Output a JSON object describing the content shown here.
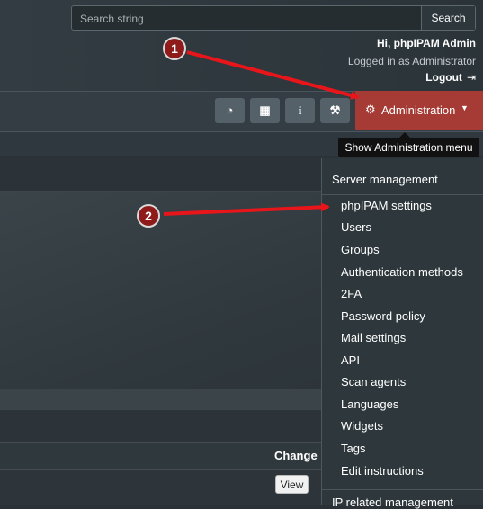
{
  "search": {
    "placeholder": "Search string",
    "button": "Search"
  },
  "user": {
    "greeting": "Hi, phpIPAM Admin",
    "logged_in_as": "Logged in as  Administrator",
    "logout": "Logout"
  },
  "navbar": {
    "icons": [
      "dashboard-icon",
      "tools-grid-icon",
      "info-icon",
      "wrench-icon"
    ],
    "admin_label": "Administration"
  },
  "tooltip": "Show Administration menu",
  "dropdown": {
    "header": "Server management",
    "items": [
      "phpIPAM settings",
      "Users",
      "Groups",
      "Authentication methods",
      "2FA",
      "Password policy",
      "Mail settings",
      "API",
      "Scan agents",
      "Languages",
      "Widgets",
      "Tags",
      "Edit instructions"
    ],
    "next_header": "IP related management"
  },
  "table": {
    "change_header": "Change",
    "view_button": "View"
  },
  "annotations": {
    "step1": "1",
    "step2": "2",
    "arrow_color": "#e8161a"
  },
  "colors": {
    "accent": "#a53b34",
    "background": "#2b3237"
  }
}
